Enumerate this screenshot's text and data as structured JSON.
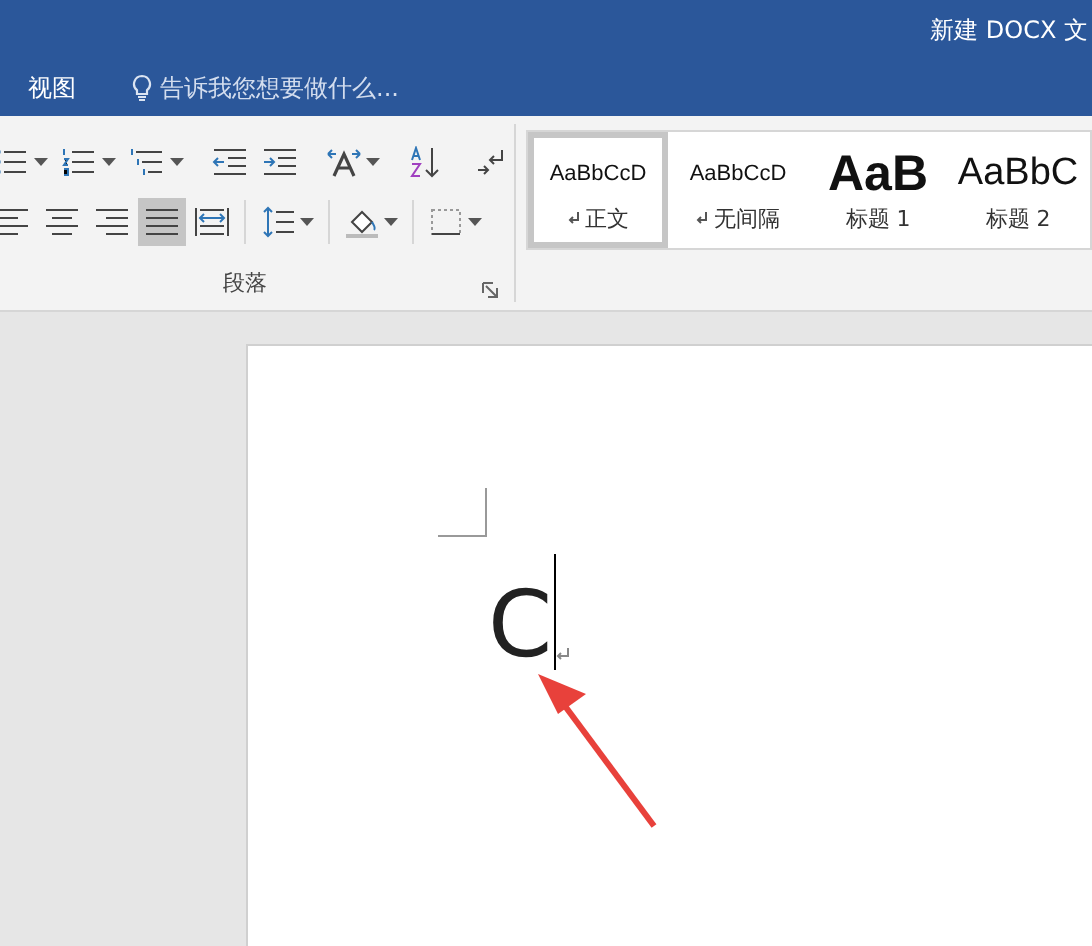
{
  "window": {
    "title": "新建 DOCX 文"
  },
  "tabs": [
    {
      "label": "视图",
      "selected": false
    }
  ],
  "tell_me": {
    "placeholder": "告诉我您想要做什么..."
  },
  "paragraph_group": {
    "label": "段落",
    "row_1": [
      {
        "kind": "bullets",
        "dropdown": true,
        "selected": false
      },
      {
        "kind": "numbering",
        "dropdown": true,
        "selected": false
      },
      {
        "kind": "multilevel",
        "dropdown": true,
        "selected": false
      },
      {
        "kind": "outdent",
        "dropdown": false,
        "selected": false
      },
      {
        "kind": "indent",
        "dropdown": false,
        "selected": false
      },
      {
        "kind": "spacing",
        "dropdown": true,
        "selected": false
      },
      {
        "kind": "sort",
        "dropdown": false,
        "selected": false
      },
      {
        "kind": "marks",
        "dropdown": false,
        "selected": false
      }
    ],
    "row_2": [
      {
        "kind": "align_left",
        "dropdown": false,
        "selected": false
      },
      {
        "kind": "align_center",
        "dropdown": false,
        "selected": false
      },
      {
        "kind": "align_right",
        "dropdown": false,
        "selected": false
      },
      {
        "kind": "justify",
        "dropdown": false,
        "selected": true
      },
      {
        "kind": "distribute",
        "dropdown": false,
        "selected": false
      },
      {
        "kind": "line_spacing",
        "dropdown": true,
        "selected": false
      },
      {
        "kind": "shading",
        "dropdown": true,
        "selected": false
      },
      {
        "kind": "borders",
        "dropdown": true,
        "selected": false
      }
    ]
  },
  "styles": [
    {
      "kind": "normal",
      "preview": "AaBbCcD",
      "name": "正文",
      "mark": true,
      "selected": true
    },
    {
      "kind": "normal",
      "preview": "AaBbCcD",
      "name": "无间隔",
      "mark": true,
      "selected": false
    },
    {
      "kind": "heading1",
      "preview": "AaB",
      "name": "标题 1",
      "mark": false,
      "selected": false
    },
    {
      "kind": "heading2",
      "preview": "AaBbC",
      "name": "标题 2",
      "mark": false,
      "selected": false
    }
  ],
  "document": {
    "text": "C"
  }
}
